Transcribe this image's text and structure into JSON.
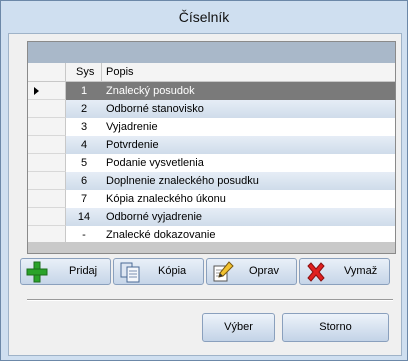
{
  "window": {
    "title": "Číselník"
  },
  "grid": {
    "columns": [
      "Sys",
      "Popis"
    ],
    "rows": [
      {
        "sys": "1",
        "popis": "Znalecký posudok",
        "selected": true
      },
      {
        "sys": "2",
        "popis": "Odborné stanovisko"
      },
      {
        "sys": "3",
        "popis": "Vyjadrenie"
      },
      {
        "sys": "4",
        "popis": "Potvrdenie"
      },
      {
        "sys": "5",
        "popis": "Podanie vysvetlenia"
      },
      {
        "sys": "6",
        "popis": "Doplnenie znaleckého posudku"
      },
      {
        "sys": "7",
        "popis": "Kópia znaleckého úkonu"
      },
      {
        "sys": "14",
        "popis": "Odborné vyjadrenie"
      },
      {
        "sys": "-",
        "popis": "Znalecké dokazovanie"
      }
    ]
  },
  "toolbar": {
    "add_label": "Pridaj",
    "copy_label": "Kópia",
    "edit_label": "Oprav",
    "delete_label": "Vymaž"
  },
  "footer": {
    "select_label": "Výber",
    "cancel_label": "Storno"
  },
  "icons": {
    "add": "plus-icon",
    "copy": "copy-icon",
    "edit": "edit-icon",
    "delete": "delete-x-icon"
  },
  "colors": {
    "selected_row": "#7a7a7a",
    "add_icon": "#2aa32a",
    "delete_icon": "#e02020"
  }
}
